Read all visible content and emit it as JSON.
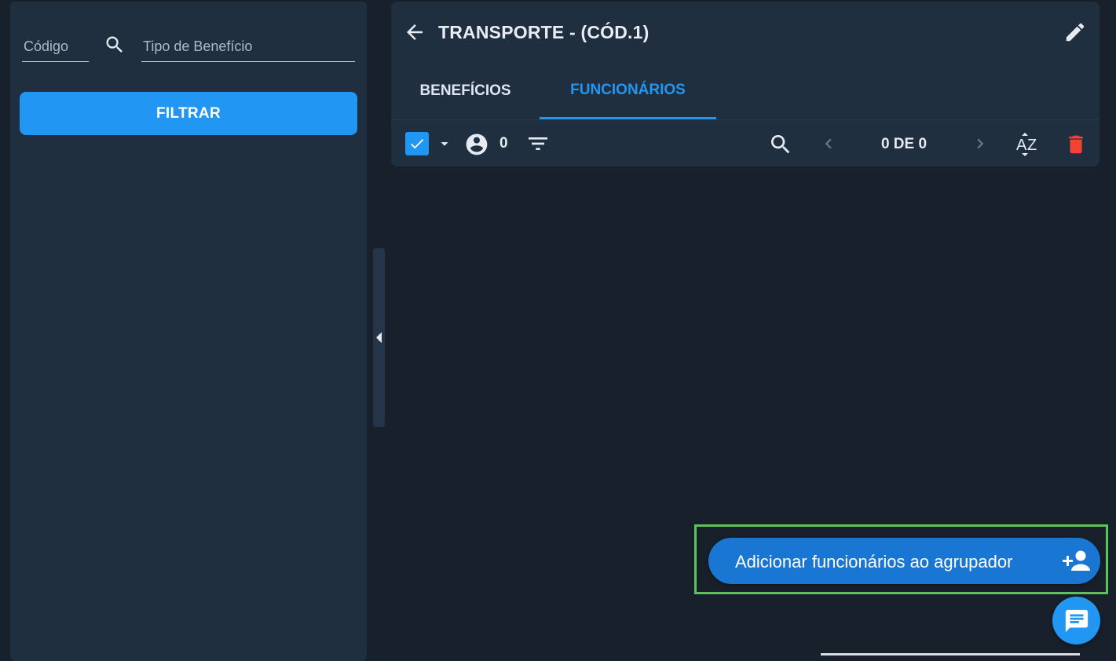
{
  "filters": {
    "code_placeholder": "Código",
    "type_placeholder": "Tipo de Benefício",
    "filter_button": "FILTRAR"
  },
  "detail": {
    "title": "TRANSPORTE - (CÓD.1)",
    "tabs": [
      {
        "label": "BENEFÍCIOS",
        "active": false
      },
      {
        "label": "FUNCIONÁRIOS",
        "active": true
      }
    ],
    "toolbar": {
      "selected_count": "0",
      "pager": "0 DE 0"
    }
  },
  "fab": {
    "add_employees_label": "Adicionar funcionários ao agrupador"
  },
  "icons": {
    "back": "arrow-left-icon",
    "edit": "pencil-icon",
    "search": "search-icon",
    "filter": "filter-list-icon",
    "sort": "sort-az-icon",
    "delete": "trash-icon",
    "user": "account-circle-icon",
    "add_person": "person-add-icon",
    "chat": "chat-icon"
  },
  "colors": {
    "accent": "#2196f3",
    "fab": "#1976d2",
    "delete": "#f44336",
    "highlight": "#5cc45c",
    "background": "#18202b",
    "panel": "#202f40"
  }
}
